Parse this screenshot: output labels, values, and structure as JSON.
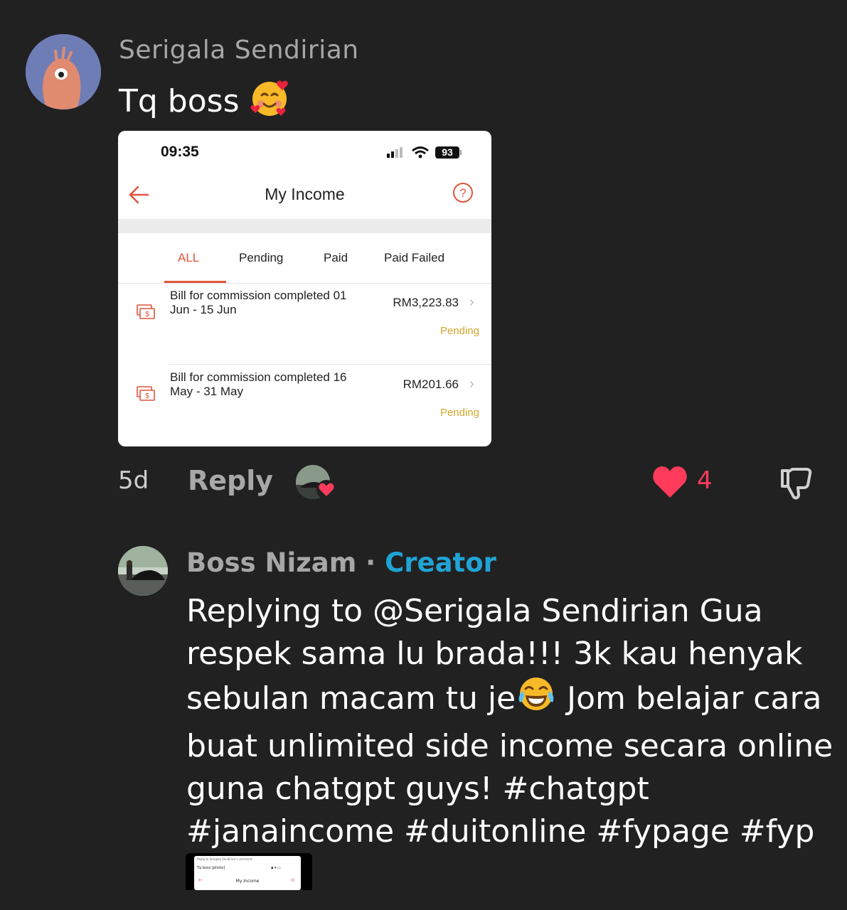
{
  "comment": {
    "username": "Serigala Sendirian",
    "text": "Tq boss",
    "age": "5d",
    "reply_label": "Reply",
    "like_count": "4"
  },
  "attachment": {
    "time": "09:35",
    "battery": "93",
    "title": "My Income",
    "tabs": [
      "ALL",
      "Pending",
      "Paid",
      "Paid Failed"
    ],
    "active_tab": "ALL",
    "items": [
      {
        "desc_line1": "Bill for commission completed 01",
        "desc_line2": "Jun - 15 Jun",
        "amount": "RM3,223.83",
        "status": "Pending"
      },
      {
        "desc_line1": "Bill for commission completed 16",
        "desc_line2": "May - 31 May",
        "amount": "RM201.66",
        "status": "Pending"
      }
    ]
  },
  "reply": {
    "username": "Boss Nizam",
    "separator": " · ",
    "badge": "Creator",
    "text_part1": "Replying to @Serigala Sendirian Gua respek sama lu brada!!! 3k kau henyak sebulan macam tu je",
    "text_part2": " Jom belajar cara buat unlimited side income secara online guna chatgpt guys! #chatgpt #janaincome #duitonline #fypage #fyp"
  },
  "thumbnail": {
    "line1": "Reply to Serigala Sendirian's comment",
    "line2": "Tq boss [photo]",
    "title": "My Income"
  },
  "colors": {
    "background": "#212121",
    "accent_orange": "#e0553a",
    "creator_blue": "#20a4d6",
    "like_red": "#ff3b5c",
    "pending_yellow": "#d4a62a"
  }
}
